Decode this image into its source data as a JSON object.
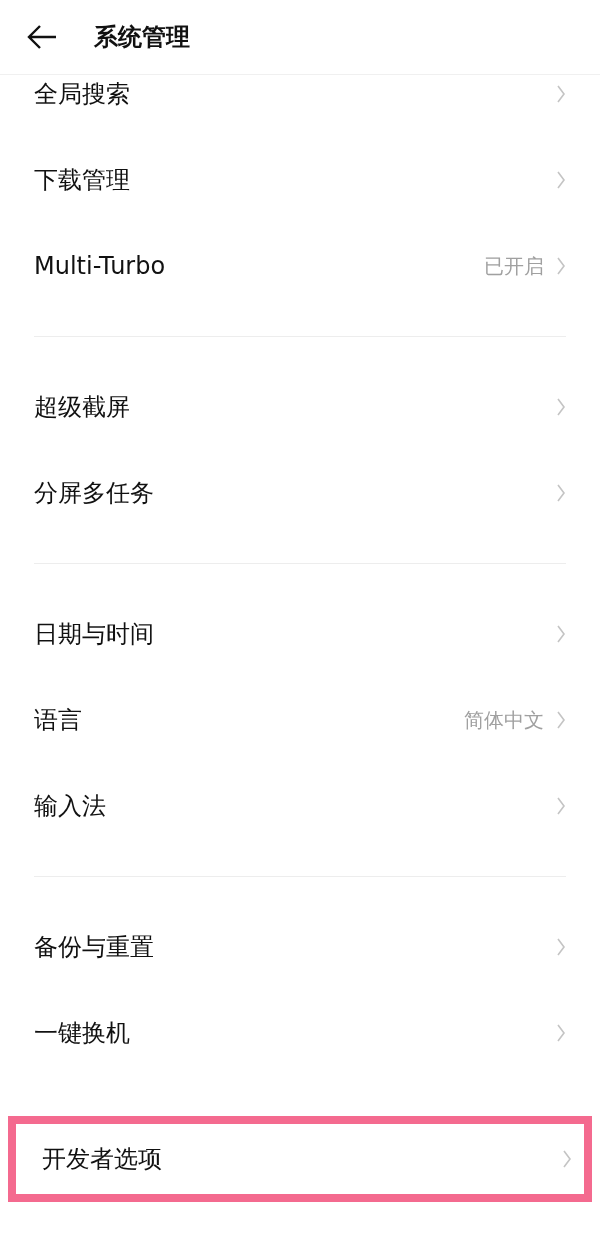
{
  "header": {
    "title": "系统管理"
  },
  "groups": [
    {
      "items": [
        {
          "label": "全局搜索",
          "highlighted": false
        },
        {
          "label": "下载管理",
          "highlighted": false
        },
        {
          "label": "Multi-Turbo",
          "value": "已开启",
          "highlighted": false
        }
      ]
    },
    {
      "items": [
        {
          "label": "超级截屏",
          "highlighted": false
        },
        {
          "label": "分屏多任务",
          "highlighted": false
        }
      ]
    },
    {
      "items": [
        {
          "label": "日期与时间",
          "highlighted": false
        },
        {
          "label": "语言",
          "value": "简体中文",
          "highlighted": false
        },
        {
          "label": "输入法",
          "highlighted": false
        }
      ]
    },
    {
      "items": [
        {
          "label": "备份与重置",
          "highlighted": false
        },
        {
          "label": "一键换机",
          "highlighted": false
        }
      ]
    },
    {
      "items": [
        {
          "label": "开发者选项",
          "highlighted": true
        }
      ]
    }
  ]
}
